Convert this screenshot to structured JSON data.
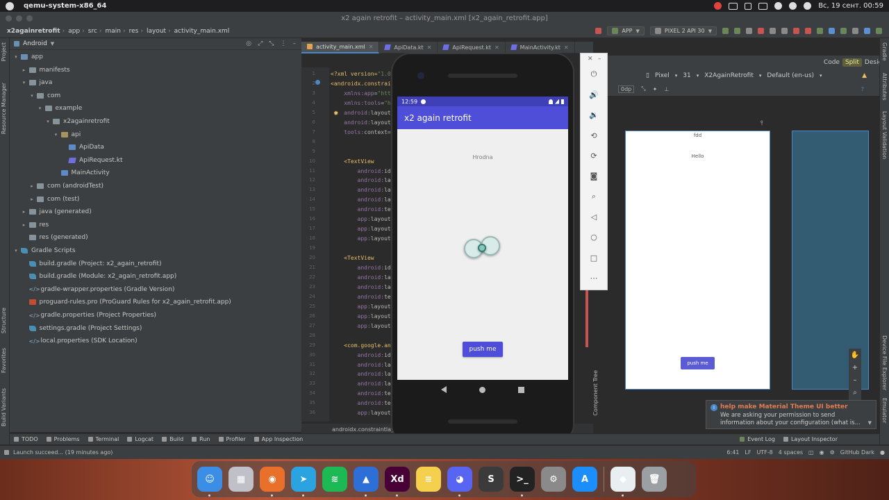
{
  "menubar": {
    "app_name": "qemu-system-x86_64",
    "clock": "Вс, 19 сент.  00:59"
  },
  "window": {
    "title": "x2 again retrofit – activity_main.xml [x2_again_retrofit.app]"
  },
  "breadcrumb": [
    "x2againretrofit",
    "app",
    "src",
    "main",
    "res",
    "layout",
    "activity_main.xml"
  ],
  "toolbar": {
    "run_config": "APP",
    "device": "PIXEL 2 API 30"
  },
  "left_tool_windows": [
    "Project",
    "Resource Manager",
    "Structure",
    "Favorites",
    "Build Variants"
  ],
  "right_tool_windows": [
    "Gradle",
    "Attributes",
    "Layout Validation",
    "Device File Explorer",
    "Emulator"
  ],
  "project": {
    "view_mode": "Android",
    "tree": [
      {
        "label": "app",
        "icon": "module",
        "depth": 0,
        "arrow": "▾"
      },
      {
        "label": "manifests",
        "icon": "folder",
        "depth": 1,
        "arrow": "▸"
      },
      {
        "label": "java",
        "icon": "folder",
        "depth": 1,
        "arrow": "▾"
      },
      {
        "label": "com",
        "icon": "folder",
        "depth": 2,
        "arrow": "▾"
      },
      {
        "label": "example",
        "icon": "folder",
        "depth": 3,
        "arrow": "▾"
      },
      {
        "label": "x2againretrofit",
        "icon": "folder",
        "depth": 4,
        "arrow": "▾"
      },
      {
        "label": "api",
        "icon": "res",
        "depth": 5,
        "arrow": "▾"
      },
      {
        "label": "ApiData",
        "icon": "source",
        "depth": 6,
        "arrow": ""
      },
      {
        "label": "ApiRequest.kt",
        "icon": "kt",
        "depth": 6,
        "arrow": ""
      },
      {
        "label": "MainActivity",
        "icon": "source",
        "depth": 5,
        "arrow": ""
      },
      {
        "label": "com (androidTest)",
        "icon": "folder",
        "depth": 2,
        "arrow": "▸"
      },
      {
        "label": "com (test)",
        "icon": "folder",
        "depth": 2,
        "arrow": "▸"
      },
      {
        "label": "java (generated)",
        "icon": "folder",
        "depth": 1,
        "arrow": "▸"
      },
      {
        "label": "res",
        "icon": "folder",
        "depth": 1,
        "arrow": "▸"
      },
      {
        "label": "res (generated)",
        "icon": "folder",
        "depth": 1,
        "arrow": ""
      },
      {
        "label": "Gradle Scripts",
        "icon": "gradle",
        "depth": 0,
        "arrow": "▾"
      },
      {
        "label": "build.gradle (Project: x2_again_retrofit)",
        "icon": "gradle",
        "depth": 1,
        "arrow": ""
      },
      {
        "label": "build.gradle (Module: x2_again_retrofit.app)",
        "icon": "gradle",
        "depth": 1,
        "arrow": ""
      },
      {
        "label": "gradle-wrapper.properties (Gradle Version)",
        "icon": "prop",
        "depth": 1,
        "arrow": ""
      },
      {
        "label": "proguard-rules.pro (ProGuard Rules for x2_again_retrofit.app)",
        "icon": "pro",
        "depth": 1,
        "arrow": ""
      },
      {
        "label": "gradle.properties (Project Properties)",
        "icon": "prop",
        "depth": 1,
        "arrow": ""
      },
      {
        "label": "settings.gradle (Project Settings)",
        "icon": "gradle",
        "depth": 1,
        "arrow": ""
      },
      {
        "label": "local.properties (SDK Location)",
        "icon": "prop",
        "depth": 1,
        "arrow": ""
      }
    ]
  },
  "editor_tabs": [
    {
      "label": "activity_main.xml",
      "type": "xml",
      "active": true
    },
    {
      "label": "ApiData.kt",
      "type": "kt",
      "active": false
    },
    {
      "label": "ApiRequest.kt",
      "type": "kt",
      "active": false
    },
    {
      "label": "MainActivity.kt",
      "type": "kt",
      "active": false
    }
  ],
  "code_lines": [
    {
      "n": "1",
      "html": "<span class='tag'>&lt;?xml version=</span><span class='str'>\"1.0</span>"
    },
    {
      "n": "2",
      "html": "<span class='tag'>&lt;androidx.constrai</span>"
    },
    {
      "n": "3",
      "html": "&nbsp;&nbsp;&nbsp;&nbsp;<span class='ns'>xmlns:app</span>=<span class='str'>\"htt</span>"
    },
    {
      "n": "4",
      "html": "&nbsp;&nbsp;&nbsp;&nbsp;<span class='ns'>xmlns:tools</span>=<span class='str'>\"h</span>"
    },
    {
      "n": "5",
      "html": "&nbsp;&nbsp;&nbsp;&nbsp;<span class='ns'>android:</span><span class='attr'>layout</span>"
    },
    {
      "n": "6",
      "html": "&nbsp;&nbsp;&nbsp;&nbsp;<span class='ns'>android:</span><span class='attr'>layout</span>"
    },
    {
      "n": "7",
      "html": "&nbsp;&nbsp;&nbsp;&nbsp;<span class='ns'>tools:</span><span class='attr'>context=</span>"
    },
    {
      "n": "8",
      "html": ""
    },
    {
      "n": "9",
      "html": ""
    },
    {
      "n": "10",
      "html": "&nbsp;&nbsp;&nbsp;&nbsp;<span class='tag'>&lt;TextView</span>"
    },
    {
      "n": "11",
      "html": "&nbsp;&nbsp;&nbsp;&nbsp;&nbsp;&nbsp;&nbsp;&nbsp;<span class='ns'>android:</span><span class='attr'>id</span>"
    },
    {
      "n": "12",
      "html": "&nbsp;&nbsp;&nbsp;&nbsp;&nbsp;&nbsp;&nbsp;&nbsp;<span class='ns'>android:</span><span class='attr'>la</span>"
    },
    {
      "n": "13",
      "html": "&nbsp;&nbsp;&nbsp;&nbsp;&nbsp;&nbsp;&nbsp;&nbsp;<span class='ns'>android:</span><span class='attr'>la</span>"
    },
    {
      "n": "14",
      "html": "&nbsp;&nbsp;&nbsp;&nbsp;&nbsp;&nbsp;&nbsp;&nbsp;<span class='ns'>android:</span><span class='attr'>la</span>"
    },
    {
      "n": "15",
      "html": "&nbsp;&nbsp;&nbsp;&nbsp;&nbsp;&nbsp;&nbsp;&nbsp;<span class='ns'>android:</span><span class='attr'>te</span>"
    },
    {
      "n": "16",
      "html": "&nbsp;&nbsp;&nbsp;&nbsp;&nbsp;&nbsp;&nbsp;&nbsp;<span class='ns'>app:</span><span class='attr'>layout</span>"
    },
    {
      "n": "17",
      "html": "&nbsp;&nbsp;&nbsp;&nbsp;&nbsp;&nbsp;&nbsp;&nbsp;<span class='ns'>app:</span><span class='attr'>layout</span>"
    },
    {
      "n": "18",
      "html": "&nbsp;&nbsp;&nbsp;&nbsp;&nbsp;&nbsp;&nbsp;&nbsp;<span class='ns'>app:</span><span class='attr'>layout</span>"
    },
    {
      "n": "19",
      "html": ""
    },
    {
      "n": "20",
      "html": "&nbsp;&nbsp;&nbsp;&nbsp;<span class='tag'>&lt;TextView</span>"
    },
    {
      "n": "21",
      "html": "&nbsp;&nbsp;&nbsp;&nbsp;&nbsp;&nbsp;&nbsp;&nbsp;<span class='ns'>android:</span><span class='attr'>id</span>"
    },
    {
      "n": "22",
      "html": "&nbsp;&nbsp;&nbsp;&nbsp;&nbsp;&nbsp;&nbsp;&nbsp;<span class='ns'>android:</span><span class='attr'>la</span>"
    },
    {
      "n": "23",
      "html": "&nbsp;&nbsp;&nbsp;&nbsp;&nbsp;&nbsp;&nbsp;&nbsp;<span class='ns'>android:</span><span class='attr'>la</span>"
    },
    {
      "n": "24",
      "html": "&nbsp;&nbsp;&nbsp;&nbsp;&nbsp;&nbsp;&nbsp;&nbsp;<span class='ns'>android:</span><span class='attr'>te</span>"
    },
    {
      "n": "25",
      "html": "&nbsp;&nbsp;&nbsp;&nbsp;&nbsp;&nbsp;&nbsp;&nbsp;<span class='ns'>app:</span><span class='attr'>layout</span>"
    },
    {
      "n": "26",
      "html": "&nbsp;&nbsp;&nbsp;&nbsp;&nbsp;&nbsp;&nbsp;&nbsp;<span class='ns'>app:</span><span class='attr'>layout</span>"
    },
    {
      "n": "27",
      "html": "&nbsp;&nbsp;&nbsp;&nbsp;&nbsp;&nbsp;&nbsp;&nbsp;<span class='ns'>app:</span><span class='attr'>layout</span>"
    },
    {
      "n": "28",
      "html": ""
    },
    {
      "n": "29",
      "html": "&nbsp;&nbsp;&nbsp;&nbsp;<span class='tag'>&lt;com.google.an</span>"
    },
    {
      "n": "30",
      "html": "&nbsp;&nbsp;&nbsp;&nbsp;&nbsp;&nbsp;&nbsp;&nbsp;<span class='ns'>android:</span><span class='attr'>id</span>"
    },
    {
      "n": "31",
      "html": "&nbsp;&nbsp;&nbsp;&nbsp;&nbsp;&nbsp;&nbsp;&nbsp;<span class='ns'>android:</span><span class='attr'>la</span>"
    },
    {
      "n": "32",
      "html": "&nbsp;&nbsp;&nbsp;&nbsp;&nbsp;&nbsp;&nbsp;&nbsp;<span class='ns'>android:</span><span class='attr'>la</span>"
    },
    {
      "n": "33",
      "html": "&nbsp;&nbsp;&nbsp;&nbsp;&nbsp;&nbsp;&nbsp;&nbsp;<span class='ns'>android:</span><span class='attr'>la</span>"
    },
    {
      "n": "34",
      "html": "&nbsp;&nbsp;&nbsp;&nbsp;&nbsp;&nbsp;&nbsp;&nbsp;<span class='ns'>android:</span><span class='attr'>te</span>"
    },
    {
      "n": "35",
      "html": "&nbsp;&nbsp;&nbsp;&nbsp;&nbsp;&nbsp;&nbsp;&nbsp;<span class='ns'>android:</span><span class='attr'>te</span>"
    },
    {
      "n": "36",
      "html": "&nbsp;&nbsp;&nbsp;&nbsp;&nbsp;&nbsp;&nbsp;&nbsp;<span class='ns'>app:</span><span class='attr'>layout</span>"
    }
  ],
  "code_breadcrumb": "androidx.constraintlay",
  "design": {
    "mode_code": "Code",
    "mode_split": "Split",
    "mode_design": "Design",
    "device": "Pixel",
    "api": "31",
    "theme": "X2AgainRetrofit",
    "locale": "Default (en-us)",
    "margin": "0dp",
    "preview_text_top": "fdd",
    "preview_text_hello": "Hello",
    "preview_button": "push me",
    "component_tree": "Component Tree"
  },
  "emulator": {
    "time": "12:59",
    "app_title": "x2 again retrofit",
    "text_view": "Hrodna",
    "button": "push me"
  },
  "bottom_tools": [
    "TODO",
    "Problems",
    "Terminal",
    "Logcat",
    "Build",
    "Run",
    "Profiler",
    "App Inspection"
  ],
  "bottom_tools_right": [
    "Event Log",
    "Layout Inspector"
  ],
  "status": {
    "message": "Launch succeed... (19 minutes ago)",
    "position": "6:41",
    "line_sep": "LF",
    "encoding": "UTF-8",
    "indent": "4 spaces",
    "theme": "GitHub Dark"
  },
  "notification": {
    "title": "help make Material Theme UI better",
    "body": "We are asking your permission to send information about your configuration (what is..."
  },
  "dock": [
    {
      "name": "finder",
      "color": "#3a8ee6",
      "glyph": "☺"
    },
    {
      "name": "launchpad",
      "color": "#c0c0c8",
      "glyph": "▦"
    },
    {
      "name": "firefox",
      "color": "#e8702a",
      "glyph": "◉"
    },
    {
      "name": "telegram",
      "color": "#2aa3e0",
      "glyph": "➤"
    },
    {
      "name": "spotify",
      "color": "#1db954",
      "glyph": "≋"
    },
    {
      "name": "xcode-instruments",
      "color": "#2d6fd6",
      "glyph": "▲"
    },
    {
      "name": "adobe-xd",
      "color": "#470137",
      "glyph": "Xd"
    },
    {
      "name": "notes",
      "color": "#f5d04c",
      "glyph": "≡"
    },
    {
      "name": "discord",
      "color": "#5865f2",
      "glyph": "◕"
    },
    {
      "name": "sublime-text",
      "color": "#3b3b3b",
      "glyph": "S"
    },
    {
      "name": "terminal",
      "color": "#222222",
      "glyph": ">_"
    },
    {
      "name": "system-preferences",
      "color": "#8a8a8a",
      "glyph": "⚙"
    },
    {
      "name": "app-store",
      "color": "#1c8ef9",
      "glyph": "A"
    },
    {
      "name": "android-studio",
      "color": "#e9eef0",
      "glyph": "◆"
    },
    {
      "name": "trash",
      "color": "#9aa0a4",
      "glyph": "🗑"
    }
  ],
  "colors": {
    "accent": "#4e4ed8",
    "ide_bg": "#2b2b2b",
    "panel_bg": "#3c3f41"
  }
}
